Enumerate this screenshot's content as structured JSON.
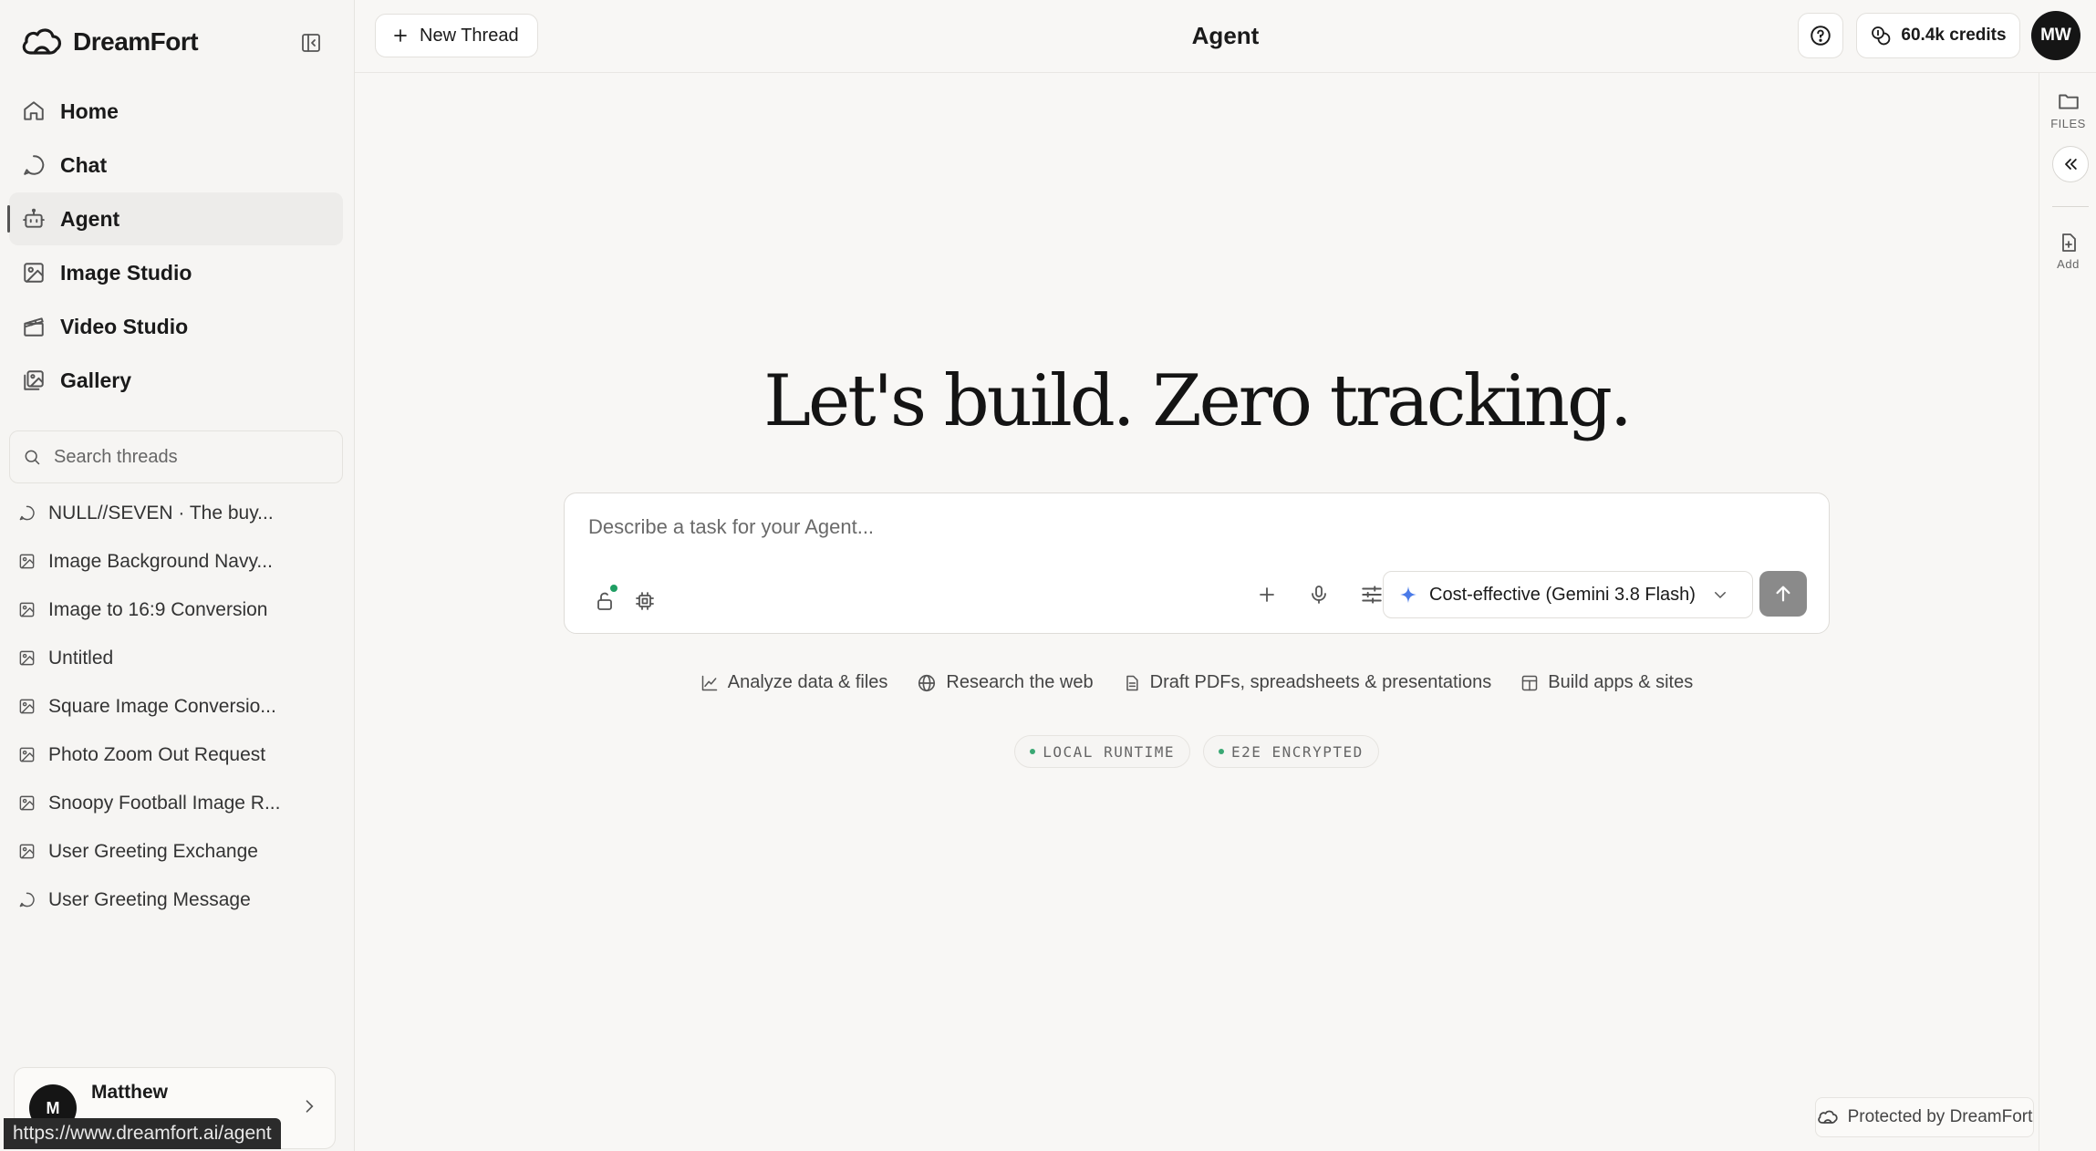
{
  "brand": {
    "name": "DreamFort"
  },
  "nav": [
    {
      "label": "Home",
      "icon": "home-icon"
    },
    {
      "label": "Chat",
      "icon": "chat-icon"
    },
    {
      "label": "Agent",
      "icon": "robot-icon",
      "active": true
    },
    {
      "label": "Image Studio",
      "icon": "image-icon"
    },
    {
      "label": "Video Studio",
      "icon": "video-icon"
    },
    {
      "label": "Gallery",
      "icon": "gallery-icon"
    }
  ],
  "search": {
    "placeholder": "Search threads"
  },
  "threads": [
    {
      "label": "NULL//SEVEN · The buy...",
      "icon": "chat-icon"
    },
    {
      "label": "Image Background Navy...",
      "icon": "image-icon"
    },
    {
      "label": "Image to 16:9 Conversion",
      "icon": "image-icon"
    },
    {
      "label": "Untitled",
      "icon": "image-icon"
    },
    {
      "label": "Square Image Conversio...",
      "icon": "image-icon"
    },
    {
      "label": "Photo Zoom Out Request",
      "icon": "image-icon"
    },
    {
      "label": "Snoopy Football Image R...",
      "icon": "image-icon"
    },
    {
      "label": "User Greeting Exchange",
      "icon": "image-icon"
    },
    {
      "label": "User Greeting Message",
      "icon": "chat-icon"
    }
  ],
  "user": {
    "name": "Matthew",
    "initial": "M"
  },
  "status_url": "https://www.dreamfort.ai/agent",
  "topbar": {
    "new_thread_label": "New Thread",
    "title": "Agent",
    "credits": "60.4k credits",
    "avatar_initials": "MW"
  },
  "rail": {
    "files_label": "FILES",
    "add_label": "Add"
  },
  "hero": {
    "headline": "Let's build. Zero tracking."
  },
  "composer": {
    "placeholder": "Describe a task for your Agent...",
    "model": "Cost-effective (Gemini 3.8 Flash)"
  },
  "suggestions": [
    "Analyze data & files",
    "Research the web",
    "Draft PDFs, spreadsheets & presentations",
    "Build apps & sites"
  ],
  "badges": [
    "LOCAL RUNTIME",
    "E2E ENCRYPTED"
  ],
  "footer": {
    "protected_label": "Protected by DreamFort"
  },
  "colors": {
    "accent_green": "#1f9e63",
    "send_button": "#8a8a8a",
    "avatar_bg": "#151515"
  }
}
